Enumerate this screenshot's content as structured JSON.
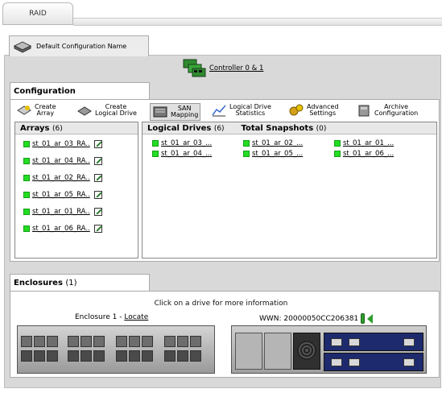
{
  "top_tab": {
    "label": "RAID"
  },
  "config_name_tab": {
    "label": "Default Configuration Name"
  },
  "controller": {
    "label": "Controller 0 & 1"
  },
  "configuration": {
    "title": "Configuration",
    "toolbar": [
      {
        "label1": "Create",
        "label2": "Array",
        "icon": "create-array-icon"
      },
      {
        "label1": "Create",
        "label2": "Logical Drive",
        "icon": "create-logical-drive-icon"
      },
      {
        "label1": "SAN",
        "label2": "Mapping",
        "icon": "san-mapping-icon"
      },
      {
        "label1": "Logical Drive",
        "label2": "Statistics",
        "icon": "statistics-icon"
      },
      {
        "label1": "Advanced",
        "label2": "Settings",
        "icon": "advanced-settings-icon"
      },
      {
        "label1": "Archive",
        "label2": "Configuration",
        "icon": "archive-configuration-icon"
      }
    ]
  },
  "arrays": {
    "title": "Arrays",
    "count": "(6)",
    "items": [
      "st_01_ar_03_RA..",
      "st_01_ar_04_RA..",
      "st_01_ar_02_RA..",
      "st_01_ar_05_RA..",
      "st_01_ar_01_RA..",
      "st_01_ar_06_RA.."
    ],
    "status_color": "#22dd22"
  },
  "logical_drives": {
    "title": "Logical Drives",
    "count": "(6)",
    "snapshots_title": "Total Snapshots",
    "snapshots_count": "(0)",
    "items": [
      "st_01_ar_03_...",
      "st_01_ar_02_...",
      "st_01_ar_01_...",
      "st_01_ar_04_...",
      "st_01_ar_05_...",
      "st_01_ar_06_..."
    ]
  },
  "enclosures": {
    "title": "Enclosures",
    "count": "(1)",
    "info": "Click on a drive for more information",
    "enclosure_name": "Enclosure 1 - ",
    "locate_label": "Locate",
    "wwn": "WWN: 20000050CC206381"
  }
}
